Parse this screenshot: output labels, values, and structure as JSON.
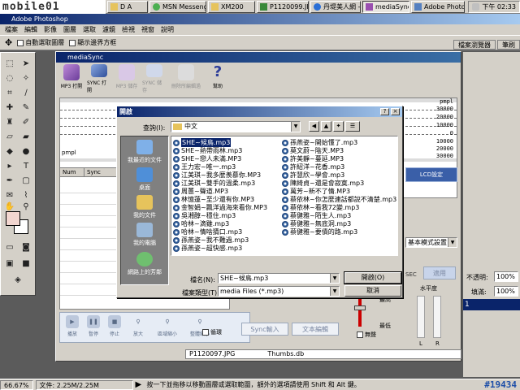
{
  "taskbar": {
    "logo_text": "mobile01",
    "buttons": [
      {
        "label": "D A"
      },
      {
        "label": "MSN Messeng..."
      },
      {
        "label": "XM200"
      },
      {
        "label": "P1120099.JPG..."
      },
      {
        "label": "丹堤美人網 -"
      },
      {
        "label": "mediaSync"
      },
      {
        "label": "Adobe Photos..."
      }
    ],
    "clock": "下午 02:33"
  },
  "photoshop": {
    "title": "Adobe Photoshop",
    "menu": [
      "檔案",
      "編輯",
      "影像",
      "圖層",
      "選取",
      "濾鏡",
      "檢視",
      "視窗",
      "說明"
    ],
    "options": {
      "auto_select": "自動選取圖層",
      "show_bounds": "顯示邊界方框"
    },
    "right_tabs": [
      "檔案瀏覽器",
      "筆刷"
    ],
    "right_panel": {
      "opacity_label": "不透明:",
      "opacity_value": "100%",
      "fill_label": "填滿:",
      "fill_value": "100%",
      "layer_label": "1"
    },
    "status": {
      "zoom": "66.67%",
      "doc": "文件: 2.25M/2.25M",
      "hint": "按一下並拖移以移動圖層或選取範圍，額外的選項請使用 Shift 和 Alt 鍵。"
    }
  },
  "watermark": "#19434",
  "mediasync": {
    "title": "mediaSync",
    "toolbar": [
      {
        "label": "MP3 打開",
        "enabled": true
      },
      {
        "label": "SYNC 打開",
        "enabled": true
      },
      {
        "label": "MP3 儲存",
        "enabled": false
      },
      {
        "label": "SYNC 儲存",
        "enabled": false
      },
      {
        "label": "刪除所編輯過",
        "enabled": false
      },
      {
        "label": "幫助",
        "enabled": true
      }
    ],
    "wave": {
      "top_label": "pmpl",
      "bottom_label": "pmpl",
      "scale_top": [
        "pmpl",
        "30000",
        "20000",
        "10000",
        "0"
      ],
      "scale_bottom": [
        "10000",
        "20000",
        "30000"
      ]
    },
    "grid_headers": [
      "Num",
      "Sync"
    ],
    "controls": [
      "播放",
      "暫停",
      "停止",
      "放大",
      "區域縮小",
      "整體縮小"
    ],
    "loop_label": "循環",
    "sync_import": "Sync輸入",
    "text_edit": "文本編輯",
    "lcd_label": "LCD設定",
    "mode_label": "基本模式設置",
    "sec_label": "SEC",
    "apply_label": "適用",
    "level_label": "水平度",
    "high_label": "最高",
    "low_label": "最低",
    "mute_label": "無聲",
    "l_label": "L",
    "r_label": "R",
    "footer_file": "P1120097.JPG",
    "footer_db": "Thumbs.db"
  },
  "dialog": {
    "title": "開啟",
    "look_in_label": "查詢(I):",
    "look_in_value": "中文",
    "places": [
      "我最近的文件",
      "桌面",
      "我的文件",
      "我的電腦",
      "網路上的芳鄰"
    ],
    "files_left": [
      "SHE~候鳥.mp3",
      "SHE~熱帶雨林.mp3",
      "SHE~戀人未滿.MP3",
      "王力宏~唯一.mp3",
      "江美琪~我多麼羨慕你.MP3",
      "江美琪~雙手的溫柔.mp3",
      "周蕙~聲道.MP3",
      "林憶蓮~至少還有你.MP3",
      "金智娟~飄洋過海來看你.MP3",
      "吳湘醇~穩住.mp3",
      "哈林~滴雖.mp3",
      "哈林~情啥猜口.mp3",
      "孫燕姿~我不難過.mp3",
      "孫燕姿~超快感.mp3"
    ],
    "files_right": [
      "孫燕姿~開始懂了.mp3",
      "莫文蔚~陰天.MP3",
      "許美靜~蔓延.MP3",
      "許紹洋~花香.mp3",
      "許慧欣~學會.mp3",
      "陳綺貞~還是會寂寞.mp3",
      "萬芳~新不了情.MP3",
      "蔡依林~你怎麼連話都說不清楚.mp3",
      "蔡依林~看我72變.mp3",
      "蔡健雅~陌生人.mp3",
      "蔡健雅~無底洞.mp3",
      "蔡健雅~要債的路.mp3"
    ],
    "selected_file": "SHE~候鳥.mp3",
    "filename_label": "檔名(N):",
    "filename_value": "SHE~候鳥.mp3",
    "filetype_label": "檔案類型(T):",
    "filetype_value": "media Files (*.mp3)",
    "open_button": "開啟(O)",
    "cancel_button": "取消",
    "help_glyph": "?",
    "close_glyph": "×"
  },
  "colors": {
    "titlebar_start": "#0a246a",
    "selection": "#0a246a",
    "foreground_swatch": "#f2d6d0",
    "watermark": "#1e4fa8"
  }
}
